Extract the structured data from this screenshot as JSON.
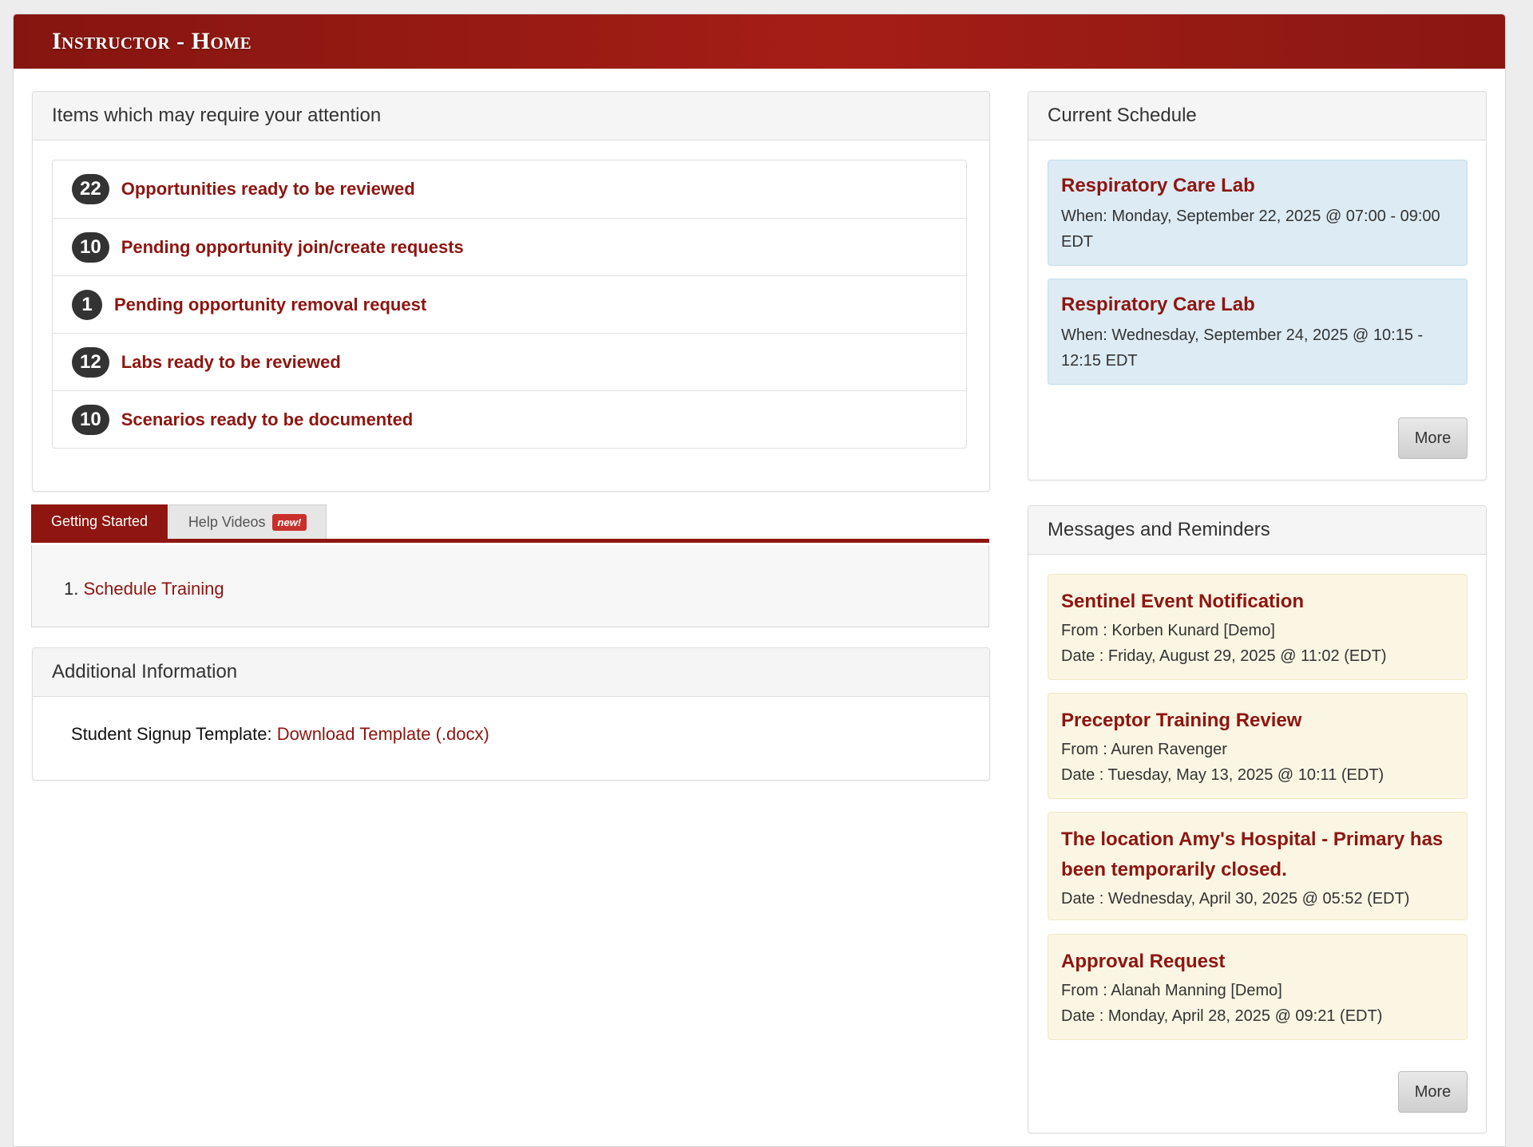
{
  "header": {
    "title": "Instructor - Home"
  },
  "attention": {
    "title": "Items which may require your attention",
    "items": [
      {
        "count": "22",
        "label": "Opportunities ready to be reviewed"
      },
      {
        "count": "10",
        "label": "Pending opportunity join/create requests"
      },
      {
        "count": "1",
        "label": "Pending opportunity removal request"
      },
      {
        "count": "12",
        "label": "Labs ready to be reviewed"
      },
      {
        "count": "10",
        "label": "Scenarios ready to be documented"
      }
    ]
  },
  "tabs": {
    "active_label": "Getting Started",
    "help_label": "Help Videos",
    "new_badge": "new!",
    "list_number": "1.",
    "training_link": "Schedule Training"
  },
  "additional": {
    "title": "Additional Information",
    "template_label": "Student Signup Template:",
    "template_link": "Download Template (.docx)"
  },
  "schedule": {
    "title": "Current Schedule",
    "items": [
      {
        "title": "Respiratory Care Lab",
        "when_line1": "When: Monday, September 22, 2025 @ 07:00 - 09:00",
        "when_line2": "EDT"
      },
      {
        "title": "Respiratory Care Lab",
        "when_line1": "When: Wednesday, September 24, 2025 @ 10:15 -",
        "when_line2": "12:15 EDT"
      }
    ],
    "more_label": "More"
  },
  "messages": {
    "title": "Messages and Reminders",
    "items": [
      {
        "title": "Sentinel Event Notification",
        "from": "From : Korben Kunard [Demo]",
        "date": "Date : Friday, August 29, 2025 @ 11:02 (EDT)"
      },
      {
        "title": "Preceptor Training Review",
        "from": "From : Auren Ravenger",
        "date": "Date : Tuesday, May 13, 2025 @ 10:11 (EDT)"
      },
      {
        "title_line1": "The location Amy's Hospital - Primary has",
        "title_line2": "been temporarily closed.",
        "date": "Date : Wednesday, April 30, 2025 @ 05:52 (EDT)"
      },
      {
        "title": "Approval Request",
        "from": "From : Alanah Manning [Demo]",
        "date": "Date : Monday, April 28, 2025 @ 09:21 (EDT)"
      }
    ],
    "more_label": "More"
  },
  "colors": {
    "brand": "#8e1510",
    "schedule_card": "#dcebf4",
    "message_card": "#fbf6e3"
  }
}
